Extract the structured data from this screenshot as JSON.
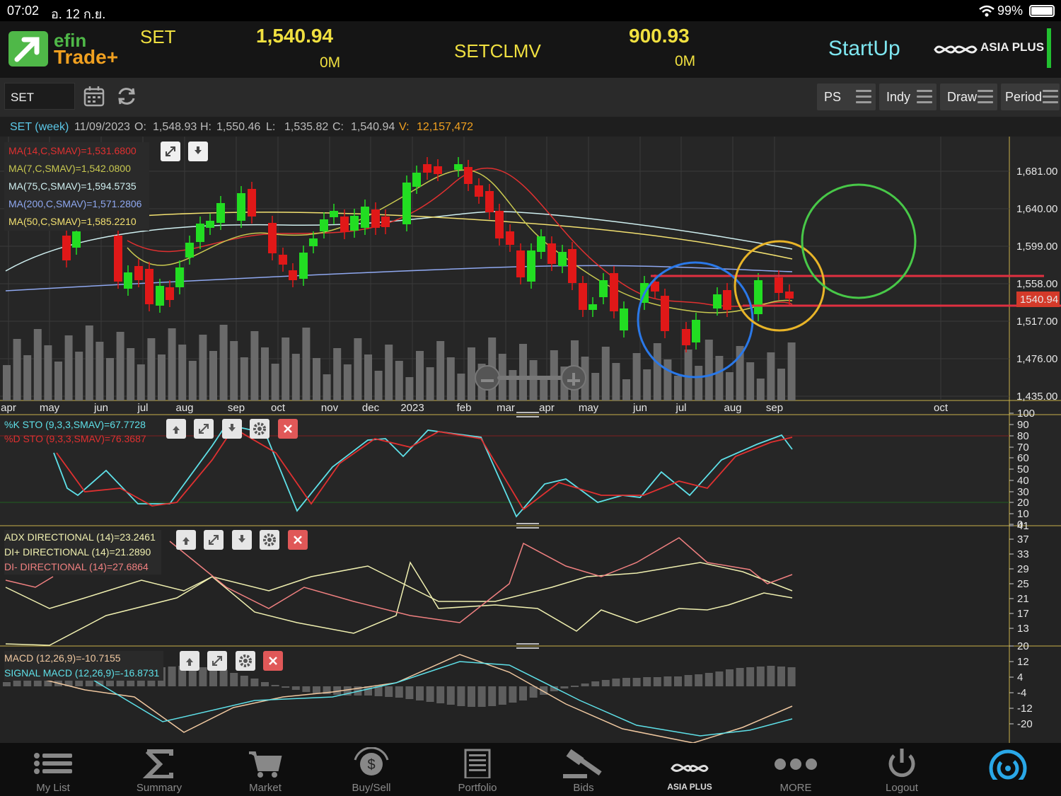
{
  "status": {
    "time": "07:02",
    "date": "อ. 12 ก.ย.",
    "battery": "99%"
  },
  "header": {
    "logo_top": "efin",
    "logo_bottom": "Trade+",
    "index1": {
      "name": "SET",
      "value": "1,540.94",
      "volume": "0M"
    },
    "index2": {
      "name": "SETCLMV",
      "value": "900.93",
      "volume": "0M"
    },
    "startup_label": "StartUp",
    "broker_logo": "ASIA PLUS"
  },
  "toolbar": {
    "symbol": "SET",
    "buttons": [
      {
        "label": "PS"
      },
      {
        "label": "Indy"
      },
      {
        "label": "Draw"
      },
      {
        "label": "Period"
      }
    ]
  },
  "info": {
    "symbol": "SET (week)",
    "date": "11/09/2023",
    "o_label": "O:",
    "o": "1,548.93",
    "h_label": "H:",
    "h": "1,550.46",
    "l_label": "L:",
    "l": "1,535.82",
    "c_label": "C:",
    "c": "1,540.94",
    "v_label": "V:",
    "v": "12,157,472"
  },
  "ma_legend": [
    {
      "text": "MA(14,C,SMAV)=1,531.6800",
      "color": "#e03030"
    },
    {
      "text": "MA(7,C,SMAV)=1,542.0800",
      "color": "#c8c850"
    },
    {
      "text": "MA(75,C,SMAV)=1,594.5735",
      "color": "#cfeff0"
    },
    {
      "text": "MA(200,C,SMAV)=1,571.2806",
      "color": "#8fa8f0"
    },
    {
      "text": "MA(50,C,SMAV)=1,585.2210",
      "color": "#f2e070"
    }
  ],
  "price_axis": [
    "1,681.00",
    "1,640.00",
    "1,599.00",
    "1,558.00",
    "1,517.00",
    "1,476.00",
    "1,435.00"
  ],
  "last_price_tag": "1540.94",
  "x_axis": [
    "apr",
    "may",
    "jun",
    "jul",
    "aug",
    "sep",
    "oct",
    "nov",
    "dec",
    "2023",
    "feb",
    "mar",
    "apr",
    "may",
    "jun",
    "jul",
    "aug",
    "sep",
    "oct"
  ],
  "sto": {
    "k_label": "%K STO (9,3,3,SMAV)=67.7728",
    "d_label": "%D STO (9,3,3,SMAV)=76.3687",
    "axis": [
      "100",
      "90",
      "80",
      "70",
      "60",
      "50",
      "40",
      "30",
      "20",
      "10",
      "0"
    ]
  },
  "adx": {
    "adx_label": "ADX DIRECTIONAL (14)=23.2461",
    "di_plus_label": "DI+ DIRECTIONAL (14)=21.2890",
    "di_minus_label": "DI- DIRECTIONAL (14)=27.6864",
    "axis": [
      "41",
      "37",
      "33",
      "29",
      "25",
      "21",
      "17",
      "13"
    ]
  },
  "macd": {
    "macd_label": "MACD (12,26,9)=-10.7155",
    "signal_label": "SIGNAL MACD (12,26,9)=-16.8731",
    "axis": [
      "20",
      "12",
      "4",
      "-4",
      "-12",
      "-20"
    ]
  },
  "nav": [
    {
      "label": "My List",
      "icon": "list-icon"
    },
    {
      "label": "Summary",
      "icon": "sigma-icon"
    },
    {
      "label": "Market",
      "icon": "cart-icon"
    },
    {
      "label": "Buy/Sell",
      "icon": "buysell-icon"
    },
    {
      "label": "Portfolio",
      "icon": "portfolio-icon"
    },
    {
      "label": "Bids",
      "icon": "gavel-icon"
    },
    {
      "label": "ASIA PLUS",
      "icon": "asiaplus-icon"
    },
    {
      "label": "MORE",
      "icon": "more-icon"
    },
    {
      "label": "Logout",
      "icon": "power-icon"
    },
    {
      "label": "",
      "icon": "refresh-circle-icon"
    }
  ],
  "colors": {
    "up": "#22dd22",
    "down": "#e01818",
    "accent": "#f0e040",
    "startup": "#7ee6f0"
  }
}
